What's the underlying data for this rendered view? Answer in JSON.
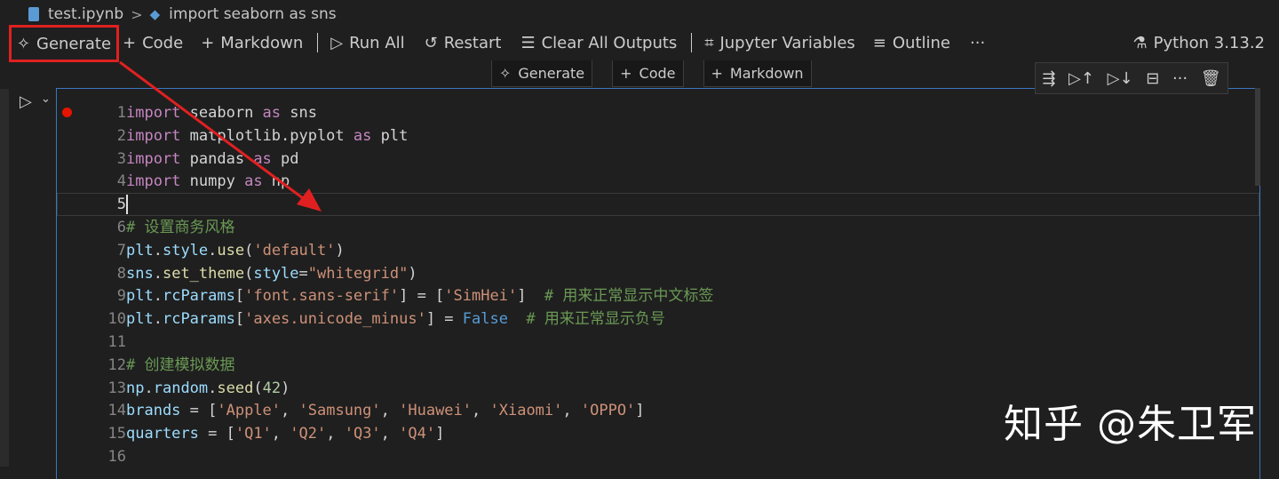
{
  "breadcrumb": {
    "file": "test.ipynb",
    "separator": ">",
    "cell": "import seaborn as sns"
  },
  "toolbar": {
    "generate": "Generate",
    "code": "Code",
    "markdown": "Markdown",
    "run_all": "Run All",
    "restart": "Restart",
    "clear_outputs": "Clear All Outputs",
    "variables": "Jupyter Variables",
    "outline": "Outline",
    "more": "···",
    "kernel": "Python 3.13.2"
  },
  "insert_bar": {
    "generate": "Generate",
    "code": "Code",
    "markdown": "Markdown"
  },
  "cell_tools": [
    "run-by-line-icon",
    "run-above-icon",
    "run-below-icon",
    "split-cell-icon",
    "more-icon",
    "delete-icon"
  ],
  "editor": {
    "active_line": 5,
    "lines": [
      {
        "n": "1"
      },
      {
        "n": "2"
      },
      {
        "n": "3"
      },
      {
        "n": "4"
      },
      {
        "n": "5"
      },
      {
        "n": "6"
      },
      {
        "n": "7"
      },
      {
        "n": "8"
      },
      {
        "n": "9"
      },
      {
        "n": "10"
      },
      {
        "n": "11"
      },
      {
        "n": "12"
      },
      {
        "n": "13"
      },
      {
        "n": "14"
      },
      {
        "n": "15"
      },
      {
        "n": "16"
      }
    ],
    "tokens": {
      "l1": [
        "import",
        " seaborn ",
        "as",
        " sns"
      ],
      "l2": [
        "import",
        " matplotlib.pyplot ",
        "as",
        " plt"
      ],
      "l3": [
        "import",
        " pandas ",
        "as",
        " pd"
      ],
      "l4": [
        "import",
        " numpy ",
        "as",
        " np"
      ],
      "l6": "# 设置商务风格",
      "l7": [
        "plt",
        ".",
        "style",
        ".",
        "use",
        "(",
        "'default'",
        ")"
      ],
      "l8": [
        "sns",
        ".",
        "set_theme",
        "(",
        "style",
        "=",
        "\"whitegrid\"",
        ")"
      ],
      "l9": [
        "plt",
        ".",
        "rcParams",
        "[",
        "'font.sans-serif'",
        "] = [",
        "'SimHei'",
        "]",
        "  # 用来正常显示中文标签"
      ],
      "l10": [
        "plt",
        ".",
        "rcParams",
        "[",
        "'axes.unicode_minus'",
        "] = ",
        "False",
        "  # 用来正常显示负号"
      ],
      "l12": "# 创建模拟数据",
      "l13": [
        "np",
        ".",
        "random",
        ".",
        "seed",
        "(",
        "42",
        ")"
      ],
      "l14": [
        "brands",
        " = [",
        "'Apple'",
        ", ",
        "'Samsung'",
        ", ",
        "'Huawei'",
        ", ",
        "'Xiaomi'",
        ", ",
        "'OPPO'",
        "]"
      ],
      "l15": [
        "quarters",
        " = [",
        "'Q1'",
        ", ",
        "'Q2'",
        ", ",
        "'Q3'",
        ", ",
        "'Q4'",
        "]"
      ]
    }
  },
  "watermark": "知乎 @朱卫军",
  "colors": {
    "highlight": "#e02020",
    "annotation_arrow": "#e02020",
    "cell_border": "#3a77c1",
    "breakpoint": "#e51400"
  }
}
